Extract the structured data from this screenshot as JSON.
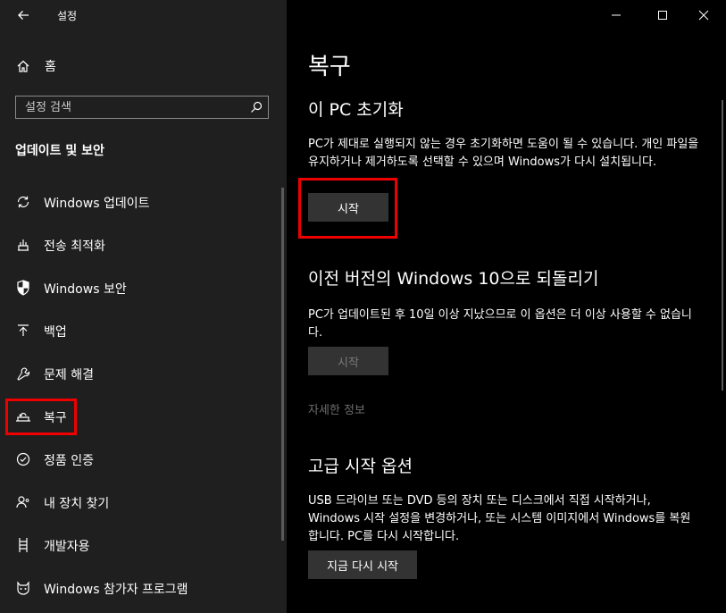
{
  "window": {
    "title": "설정",
    "back_label": "←",
    "minimize_label": "—",
    "close_label": "✕"
  },
  "sidebar": {
    "home_label": "홈",
    "search_placeholder": "설정 검색",
    "section_title": "업데이트 및 보안",
    "items": [
      {
        "label": "Windows 업데이트",
        "icon": "sync-icon"
      },
      {
        "label": "전송 최적화",
        "icon": "delivery-optimization-icon"
      },
      {
        "label": "Windows 보안",
        "icon": "shield-icon"
      },
      {
        "label": "백업",
        "icon": "upload-arrow-icon"
      },
      {
        "label": "문제 해결",
        "icon": "wrench-icon"
      },
      {
        "label": "복구",
        "icon": "recovery-icon",
        "selected": true
      },
      {
        "label": "정품 인증",
        "icon": "check-circle-icon"
      },
      {
        "label": "내 장치 찾기",
        "icon": "person-location-icon"
      },
      {
        "label": "개발자용",
        "icon": "developer-icon"
      },
      {
        "label": "Windows 참가자 프로그램",
        "icon": "cat-icon"
      }
    ]
  },
  "main": {
    "page_title": "복구",
    "reset": {
      "heading": "이 PC 초기화",
      "description": "PC가 제대로 실행되지 않는 경우 초기화하면 도움이 될 수 있습니다. 개인 파일을 유지하거나 제거하도록 선택할 수 있으며 Windows가 다시 설치됩니다.",
      "button": "시작"
    },
    "go_back": {
      "heading": "이전 버전의 Windows 10으로 되돌리기",
      "description": "PC가 업데이트된 후 10일 이상 지났으므로 이 옵션은 더 이상 사용할 수 없습니다.",
      "button": "시작",
      "button_enabled": false,
      "link": "자세한 정보"
    },
    "advanced": {
      "heading": "고급 시작 옵션",
      "description": "USB 드라이브 또는 DVD 등의 장치 또는 디스크에서 직접 시작하거나, Windows 시작 설정을 변경하거나, 또는 시스템 이미지에서 Windows를 복원합니다. PC를 다시 시작합니다.",
      "button": "지금 다시 시작"
    }
  },
  "colors": {
    "sidebar_bg": "#1f1f1f",
    "main_bg": "#000000",
    "button_bg": "#333333",
    "highlight": "#e00000"
  }
}
